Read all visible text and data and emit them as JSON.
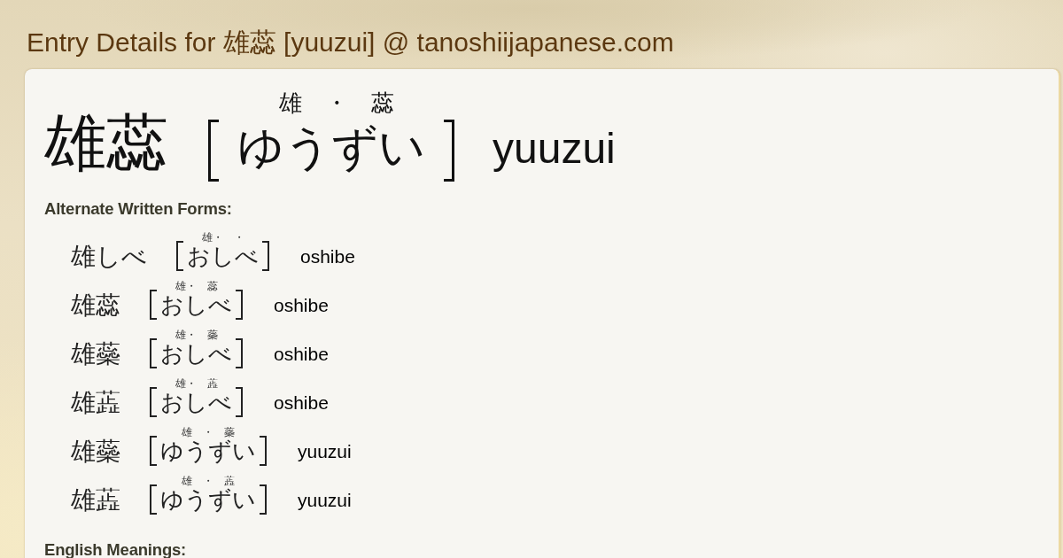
{
  "page_title": "Entry Details for 雄蕊 [yuuzui] @ tanoshiijapanese.com",
  "entry": {
    "written": "雄蕊",
    "furigana": "雄　・　蕊",
    "reading": "ゆうずい",
    "romaji": "yuuzui"
  },
  "alternate_forms": {
    "heading": "Alternate Written Forms:",
    "items": [
      {
        "written": "雄しべ",
        "furigana": "雄・　・",
        "reading": "おしべ",
        "romaji": "oshibe"
      },
      {
        "written": "雄蕊",
        "furigana": "雄・　蕊",
        "reading": "おしべ",
        "romaji": "oshibe"
      },
      {
        "written": "雄蘂",
        "furigana": "雄・　蘂",
        "reading": "おしべ",
        "romaji": "oshibe"
      },
      {
        "written": "雄蕋",
        "furigana": "雄・　蕋",
        "reading": "おしべ",
        "romaji": "oshibe"
      },
      {
        "written": "雄蘂",
        "furigana": "雄　・　蘂",
        "reading": "ゆうずい",
        "romaji": "yuuzui"
      },
      {
        "written": "雄蕋",
        "furigana": "雄　・　蕋",
        "reading": "ゆうずい",
        "romaji": "yuuzui"
      }
    ]
  },
  "english_meanings": {
    "heading": "English Meanings:"
  }
}
